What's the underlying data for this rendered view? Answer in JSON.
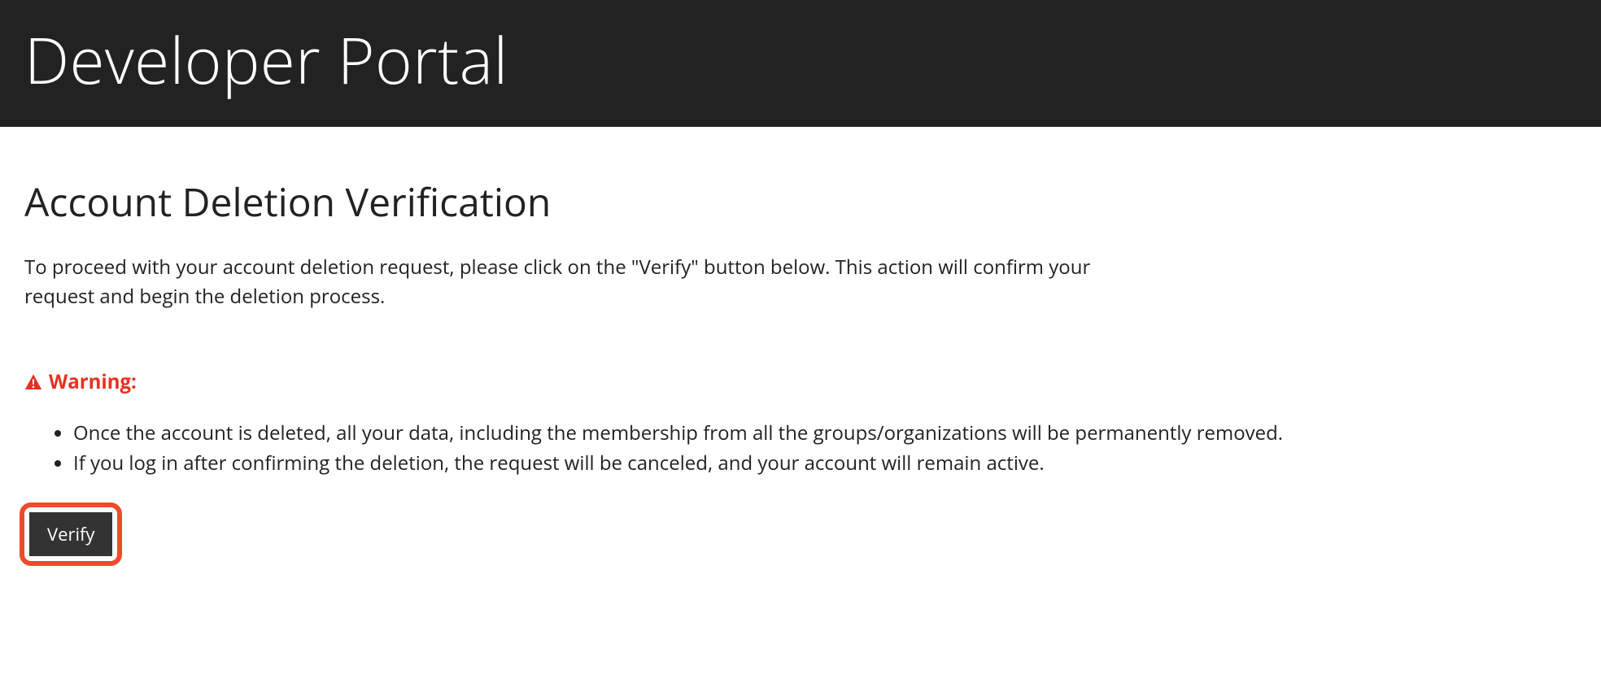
{
  "header": {
    "title": "Developer Portal"
  },
  "main": {
    "heading": "Account Deletion Verification",
    "intro": "To proceed with your account deletion request, please click on the \"Verify\" button below. This action will confirm your request and begin the deletion process.",
    "warning": {
      "label": "Warning:",
      "items": [
        "Once the account is deleted, all your data, including the membership from all the groups/organizations will be permanently removed.",
        "If you log in after confirming the deletion, the request will be canceled, and your account will remain active."
      ]
    },
    "verify_label": "Verify"
  }
}
